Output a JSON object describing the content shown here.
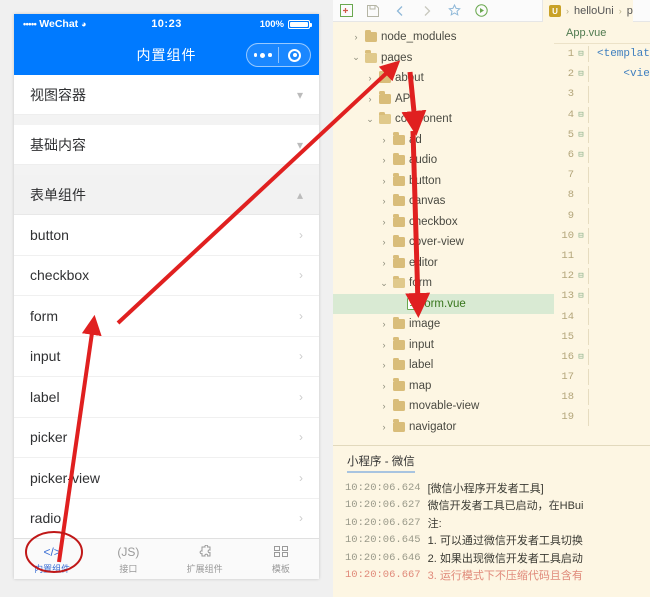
{
  "simulator": {
    "status_bar": {
      "carrier": "WeChat",
      "signal_dots": "•••••",
      "wifi_icon": "wifi-icon",
      "time": "10:23",
      "battery_percent": "100%",
      "battery_icon": "battery-full-icon"
    },
    "nav": {
      "title": "内置组件",
      "capsule_menu_icon": "more-dots-icon",
      "capsule_close_icon": "target-circle-icon"
    },
    "groups": [
      {
        "label": "视图容器",
        "state": "collapsed",
        "icon": "chevron-down-icon",
        "style": "white"
      },
      {
        "label": "基础内容",
        "state": "collapsed",
        "icon": "chevron-down-icon",
        "style": "white"
      },
      {
        "label": "表单组件",
        "state": "expanded",
        "icon": "chevron-up-icon",
        "style": "gray"
      }
    ],
    "items": [
      {
        "label": "button",
        "arrow": "chevron-right-icon"
      },
      {
        "label": "checkbox",
        "arrow": "chevron-right-icon"
      },
      {
        "label": "form",
        "arrow": "chevron-right-icon"
      },
      {
        "label": "input",
        "arrow": "chevron-right-icon"
      },
      {
        "label": "label",
        "arrow": "chevron-right-icon"
      },
      {
        "label": "picker",
        "arrow": "chevron-right-icon"
      },
      {
        "label": "picker-view",
        "arrow": "chevron-right-icon"
      },
      {
        "label": "radio",
        "arrow": "chevron-right-icon"
      }
    ],
    "tabbar": [
      {
        "label": "内置组件",
        "icon": "code-brackets-icon",
        "glyph": "</>",
        "active": true
      },
      {
        "label": "接口",
        "icon": "js-icon",
        "glyph": "(JS)",
        "active": false
      },
      {
        "label": "扩展组件",
        "icon": "puzzle-icon",
        "glyph": "✧",
        "active": false
      },
      {
        "label": "模板",
        "icon": "grid-blocks-icon",
        "glyph": "▣▤",
        "active": false
      }
    ],
    "accent_color": "#007AFF",
    "active_tab_color": "#3b6fd4"
  },
  "ide": {
    "toolbar_icons": [
      {
        "name": "new-file-icon",
        "glyph": "⊞"
      },
      {
        "name": "save-icon",
        "glyph": "🖫"
      },
      {
        "name": "back-arrow-icon",
        "glyph": "‹"
      },
      {
        "name": "forward-arrow-icon",
        "glyph": "›"
      },
      {
        "name": "favorite-star-icon",
        "glyph": "☆"
      },
      {
        "name": "run-play-icon",
        "glyph": "▷"
      }
    ],
    "breadcrumb": {
      "badge": "U",
      "items": [
        "helloUni",
        "p"
      ],
      "separator": "›"
    },
    "tree": [
      {
        "label": "node_modules",
        "depth": 1,
        "twisty": "›",
        "type": "folder",
        "open": false,
        "selected": false
      },
      {
        "label": "pages",
        "depth": 1,
        "twisty": "⌄",
        "type": "folder",
        "open": true,
        "selected": false
      },
      {
        "label": "about",
        "depth": 2,
        "twisty": "›",
        "type": "folder",
        "open": false,
        "selected": false
      },
      {
        "label": "API",
        "depth": 2,
        "twisty": "›",
        "type": "folder",
        "open": false,
        "selected": false
      },
      {
        "label": "component",
        "depth": 2,
        "twisty": "⌄",
        "type": "folder",
        "open": true,
        "selected": false
      },
      {
        "label": "ad",
        "depth": 3,
        "twisty": "›",
        "type": "folder",
        "open": false,
        "selected": false
      },
      {
        "label": "audio",
        "depth": 3,
        "twisty": "›",
        "type": "folder",
        "open": false,
        "selected": false
      },
      {
        "label": "button",
        "depth": 3,
        "twisty": "›",
        "type": "folder",
        "open": false,
        "selected": false
      },
      {
        "label": "canvas",
        "depth": 3,
        "twisty": "›",
        "type": "folder",
        "open": false,
        "selected": false
      },
      {
        "label": "checkbox",
        "depth": 3,
        "twisty": "›",
        "type": "folder",
        "open": false,
        "selected": false
      },
      {
        "label": "cover-view",
        "depth": 3,
        "twisty": "›",
        "type": "folder",
        "open": false,
        "selected": false
      },
      {
        "label": "editor",
        "depth": 3,
        "twisty": "›",
        "type": "folder",
        "open": false,
        "selected": false
      },
      {
        "label": "form",
        "depth": 3,
        "twisty": "⌄",
        "type": "folder",
        "open": true,
        "selected": false
      },
      {
        "label": "form.vue",
        "depth": 4,
        "twisty": "",
        "type": "file",
        "open": false,
        "selected": true
      },
      {
        "label": "image",
        "depth": 3,
        "twisty": "›",
        "type": "folder",
        "open": false,
        "selected": false
      },
      {
        "label": "input",
        "depth": 3,
        "twisty": "›",
        "type": "folder",
        "open": false,
        "selected": false
      },
      {
        "label": "label",
        "depth": 3,
        "twisty": "›",
        "type": "folder",
        "open": false,
        "selected": false
      },
      {
        "label": "map",
        "depth": 3,
        "twisty": "›",
        "type": "folder",
        "open": false,
        "selected": false
      },
      {
        "label": "movable-view",
        "depth": 3,
        "twisty": "›",
        "type": "folder",
        "open": false,
        "selected": false
      },
      {
        "label": "navigator",
        "depth": 3,
        "twisty": "›",
        "type": "folder",
        "open": false,
        "selected": false
      }
    ],
    "editor": {
      "tab_label": "App.vue",
      "lines": [
        {
          "n": "1",
          "fold": "⊟",
          "text": "<templat"
        },
        {
          "n": "2",
          "fold": "⊟",
          "text": "    <vie"
        },
        {
          "n": "3",
          "fold": "",
          "text": ""
        },
        {
          "n": "4",
          "fold": "⊟",
          "text": ""
        },
        {
          "n": "5",
          "fold": "⊟",
          "text": ""
        },
        {
          "n": "6",
          "fold": "⊟",
          "text": ""
        },
        {
          "n": "7",
          "fold": "",
          "text": ""
        },
        {
          "n": "8",
          "fold": "",
          "text": ""
        },
        {
          "n": "9",
          "fold": "",
          "text": ""
        },
        {
          "n": "10",
          "fold": "⊟",
          "text": ""
        },
        {
          "n": "11",
          "fold": "",
          "text": ""
        },
        {
          "n": "12",
          "fold": "⊟",
          "text": ""
        },
        {
          "n": "13",
          "fold": "⊟",
          "text": ""
        },
        {
          "n": "14",
          "fold": "",
          "text": ""
        },
        {
          "n": "15",
          "fold": "",
          "text": ""
        },
        {
          "n": "16",
          "fold": "⊟",
          "text": ""
        },
        {
          "n": "17",
          "fold": "",
          "text": ""
        },
        {
          "n": "18",
          "fold": "",
          "text": ""
        },
        {
          "n": "19",
          "fold": "",
          "text": ""
        }
      ]
    },
    "console": {
      "title": "小程序 - 微信",
      "logs": [
        {
          "time": "10:20:06.624",
          "message": "[微信小程序开发者工具]",
          "warn": false
        },
        {
          "time": "10:20:06.627",
          "message": "微信开发者工具已启动，在HBui",
          "warn": false
        },
        {
          "time": "10:20:06.627",
          "message": "注:",
          "warn": false
        },
        {
          "time": "10:20:06.645",
          "message": "1. 可以通过微信开发者工具切换",
          "warn": false
        },
        {
          "time": "10:20:06.646",
          "message": "2. 如果出现微信开发者工具启动",
          "warn": false
        },
        {
          "time": "10:20:06.667",
          "message": "3. 运行模式下不压缩代码且含有",
          "warn": true
        }
      ]
    }
  },
  "annotations": {
    "color": "#e02020",
    "arrows": [
      {
        "name": "arrow-form-row-to-pages-folder"
      },
      {
        "name": "arrow-pages-to-component-folder"
      },
      {
        "name": "arrow-component-to-form-vue"
      },
      {
        "name": "arrow-tabbar-to-form-row"
      }
    ],
    "ellipse": {
      "name": "highlight-ellipse-builtin-components-tab"
    }
  }
}
